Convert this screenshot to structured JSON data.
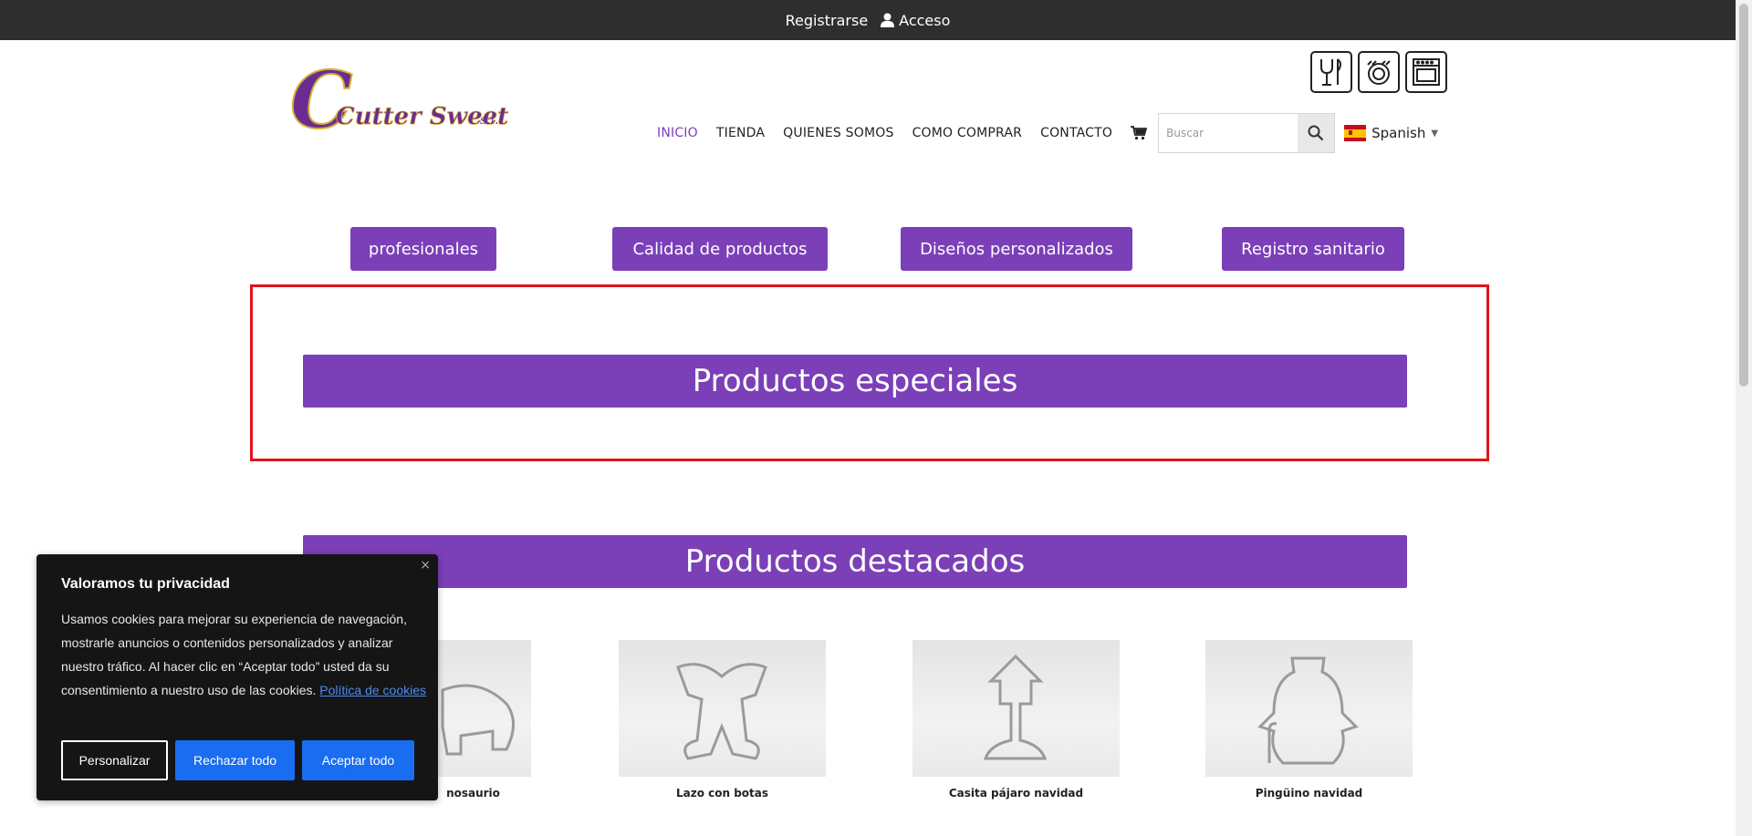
{
  "topbar": {
    "register": "Registrarse",
    "login": "Acceso"
  },
  "logo": {
    "text": "Cutter Sweet",
    "suffix": "s.l.",
    "letter": "C"
  },
  "certifications": [
    "food-safe-icon",
    "dishwasher-safe-icon",
    "oven-safe-icon"
  ],
  "nav": {
    "items": [
      "INICIO",
      "TIENDA",
      "QUIENES SOMOS",
      "COMO COMPRAR",
      "CONTACTO"
    ],
    "active": "INICIO"
  },
  "search": {
    "placeholder": "Buscar"
  },
  "language": {
    "label": "Spanish"
  },
  "pills": [
    "profesionales",
    "Calidad de productos",
    "Diseños personalizados",
    "Registro sanitario"
  ],
  "sections": {
    "special": "Productos especiales",
    "featured": "Productos destacados"
  },
  "products": [
    {
      "name": "Dinosaurio",
      "visible_name": "nosaurio"
    },
    {
      "name": "Lazo con botas"
    },
    {
      "name": "Casita pájaro navidad"
    },
    {
      "name": "Pingüino navidad"
    }
  ],
  "cookie": {
    "title": "Valoramos tu privacidad",
    "body": "Usamos cookies para mejorar su experiencia de navegación, mostrarle anuncios o contenidos personalizados y analizar nuestro tráfico. Al hacer clic en “Aceptar todo” usted da su consentimiento a nuestro uso de las cookies.",
    "policy_link": "Política de cookies",
    "customize": "Personalizar",
    "reject": "Rechazar todo",
    "accept": "Aceptar todo",
    "close": "×"
  },
  "colors": {
    "brand_purple": "#7b3fb8",
    "topbar": "#2e2e2e",
    "highlight_red": "#e0141a",
    "cookie_blue": "#1a6df0"
  }
}
